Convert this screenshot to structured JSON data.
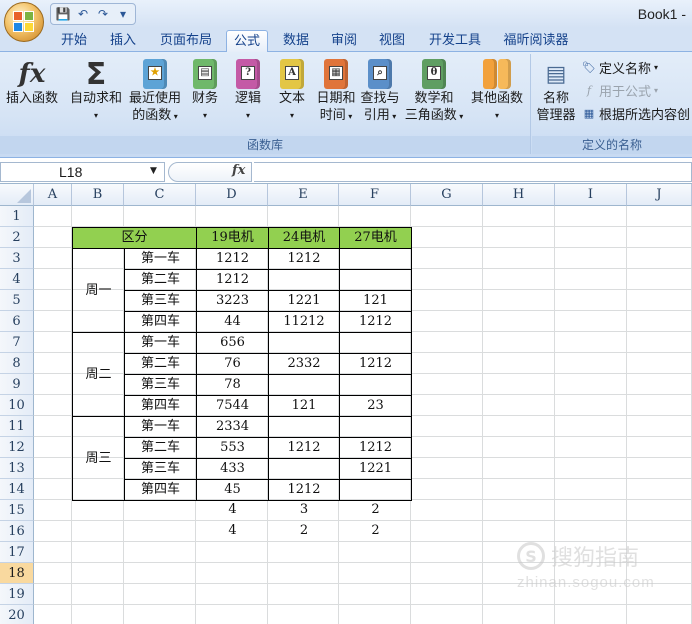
{
  "window": {
    "title": "Book1 -"
  },
  "quick_access": [
    {
      "name": "save-icon",
      "glyph": "💾"
    },
    {
      "name": "undo-icon",
      "glyph": "↶"
    },
    {
      "name": "redo-icon",
      "glyph": "↷"
    },
    {
      "name": "customize-qat-icon",
      "glyph": "▾"
    }
  ],
  "ribbon_tabs": [
    "开始",
    "插入",
    "页面布局",
    "公式",
    "数据",
    "审阅",
    "视图",
    "开发工具",
    "福昕阅读器"
  ],
  "active_tab": "公式",
  "ribbon": {
    "function_library": {
      "label": "函数库",
      "insert_function": "插入函数",
      "autosum": "自动求和",
      "recent_line1": "最近使用",
      "recent_line2": "的函数",
      "financial": "财务",
      "logical": "逻辑",
      "text": "文本",
      "datetime_line1": "日期和",
      "datetime_line2": "时间",
      "lookup_line1": "查找与",
      "lookup_line2": "引用",
      "math_line1": "数学和",
      "math_line2": "三角函数",
      "other": "其他函数"
    },
    "defined_names": {
      "label": "定义的名称",
      "name_manager_line1": "名称",
      "name_manager_line2": "管理器",
      "define_name": "定义名称",
      "use_in_formula": "用于公式",
      "create_from_selection": "根据所选内容创"
    }
  },
  "formula_bar": {
    "name_box": "L18",
    "fx_label": "fx",
    "formula": ""
  },
  "columns": [
    "A",
    "B",
    "C",
    "D",
    "E",
    "F",
    "G",
    "H",
    "I",
    "J"
  ],
  "rows": [
    "1",
    "2",
    "3",
    "4",
    "5",
    "6",
    "7",
    "8",
    "9",
    "10",
    "11",
    "12",
    "13",
    "14",
    "15",
    "16",
    "17",
    "18",
    "19",
    "20"
  ],
  "selected_row": "18",
  "table": {
    "header": {
      "category": "区分",
      "d": "19电机",
      "e": "24电机",
      "f": "27电机"
    },
    "groups": [
      "周一",
      "周二",
      "周三"
    ],
    "car_labels": [
      "第一车",
      "第二车",
      "第三车",
      "第四车"
    ],
    "values": [
      [
        "1212",
        "1212",
        ""
      ],
      [
        "1212",
        "",
        ""
      ],
      [
        "3223",
        "1221",
        "121"
      ],
      [
        "44",
        "11212",
        "1212"
      ],
      [
        "656",
        "",
        ""
      ],
      [
        "76",
        "2332",
        "1212"
      ],
      [
        "78",
        "",
        ""
      ],
      [
        "7544",
        "121",
        "23"
      ],
      [
        "2334",
        "",
        ""
      ],
      [
        "553",
        "1212",
        "1212"
      ],
      [
        "433",
        "",
        "1221"
      ],
      [
        "45",
        "1212",
        ""
      ]
    ],
    "counts": [
      [
        "4",
        "3",
        "2"
      ],
      [
        "4",
        "2",
        "2"
      ]
    ]
  },
  "watermark": {
    "line1": "搜狗指南",
    "line2": "zhinan.sogou.com",
    "logo": "S"
  }
}
